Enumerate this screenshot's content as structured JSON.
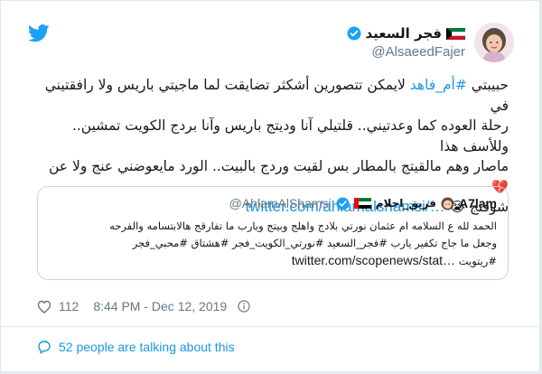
{
  "author": {
    "display_name": "فجر السعيد",
    "handle": "@AlsaeedFajer"
  },
  "tweet": {
    "line1_pre": "حبيبتي ",
    "line1_hash": "#أم_فاهد",
    "line1_post": " لايمكن تتصورين أشكثر تضايقت لما ماجيتي باريس ولا رافقتيني في",
    "line2": "رحلة العوده كما وعدتيني.. قلتيلي آنا وديتج باريس وآنا بردج الكويت تمشين.. وللأسف هذا",
    "line3": "ماصار وهم مالقيتج بالمطار بس لقيت وردج بالبيت.. الورد مايعوضني عنج ولا عن",
    "line4_pre": "شوفتج ",
    "link": "twitter.com/ahlamalshamsi/…",
    "emoji_broken_heart": "💔",
    "emoji_cry": "😭"
  },
  "quoted": {
    "brand_name": "A7lam",
    "name_ar": "فريق_احلام",
    "handle": "@AhlamAlShamsi",
    "line1": "الحمد لله ع السلامه ام عثمان نورتي بلادج واهلج وبيتج ويارب ما تفارقج هالابتسامه والفرحه",
    "line2": "وجعل ما جاج تكفير يارب #فجر_السعيد #نورتي_الكويت_فجر #هشتاق #محبي_فجر",
    "line3_tag": "#ريتويت",
    "line3_link": "twitter.com/scopenews/stat…"
  },
  "stats": {
    "likes": "112",
    "timestamp": "8:44 PM - Dec 12, 2019"
  },
  "talking": {
    "label": "52 people are talking about this"
  },
  "colors": {
    "accent": "#1b95e0",
    "secondary_text": "#657786",
    "border": "#e1e8ed"
  },
  "icons": [
    "twitter-bird-icon",
    "verified-badge-icon",
    "kuwait-flag-icon",
    "uae-flag-icon",
    "heart-icon",
    "info-icon",
    "speech-bubble-icon"
  ]
}
